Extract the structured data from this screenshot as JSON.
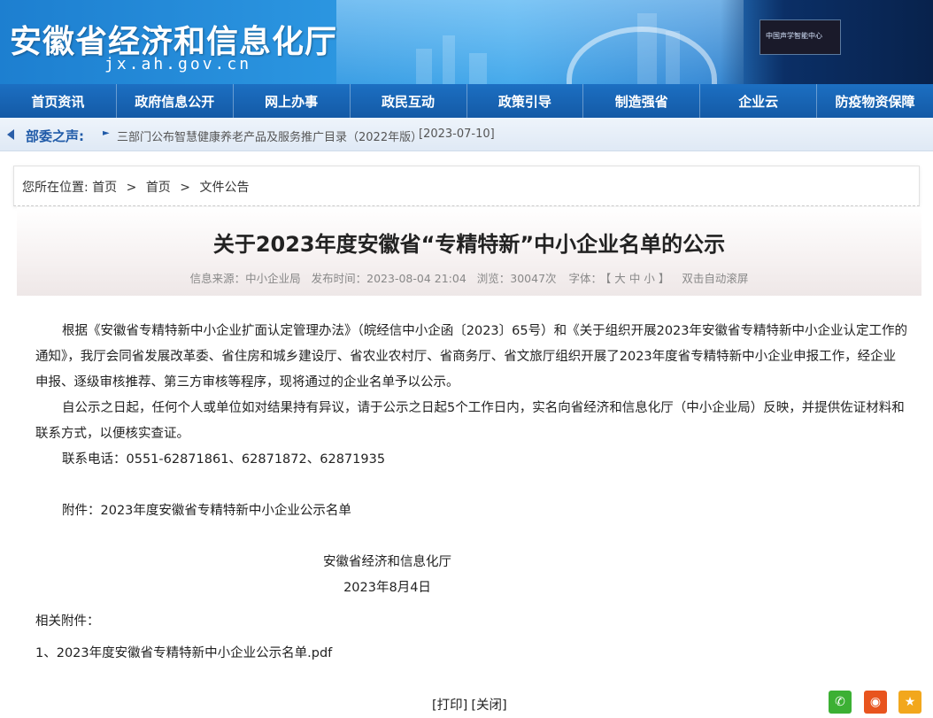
{
  "header": {
    "site_title": "安徽省经济和信息化厅",
    "site_domain": "jx.ah.gov.cn",
    "screen_text": "中国声学智能中心"
  },
  "nav": {
    "items": [
      {
        "label": "首页资讯"
      },
      {
        "label": "政府信息公开"
      },
      {
        "label": "网上办事"
      },
      {
        "label": "政民互动"
      },
      {
        "label": "政策引导"
      },
      {
        "label": "制造强省"
      },
      {
        "label": "企业云"
      },
      {
        "label": "防疫物资保障"
      }
    ]
  },
  "notice": {
    "label": "部委之声:",
    "text": "三部门公布智慧健康养老产品及服务推广目录（2022年版）",
    "date": "[2023-07-10]"
  },
  "breadcrumb": {
    "prefix": "您所在位置:",
    "items": [
      "首页",
      "首页",
      "文件公告"
    ],
    "separator": ">"
  },
  "article": {
    "title": "关于2023年度安徽省“专精特新”中小企业名单的公示",
    "meta": {
      "source": "信息来源：中小企业局",
      "published": "发布时间：2023-08-04 21:04",
      "views": "浏览：30047次",
      "font_label": "字体：",
      "font_open": "【",
      "font_large": "大",
      "font_medium": "中",
      "font_small": "小",
      "font_close": "】",
      "autoscroll": "双击自动滚屏"
    },
    "paragraphs": [
      "根据《安徽省专精特新中小企业扩面认定管理办法》（皖经信中小企函〔2023〕65号）和《关于组织开展2023年安徽省专精特新中小企业认定工作的通知》，我厅会同省发展改革委、省住房和城乡建设厅、省农业农村厅、省商务厅、省文旅厅组织开展了2023年度省专精特新中小企业申报工作，经企业申报、逐级审核推荐、第三方审核等程序，现将通过的企业名单予以公示。",
      "自公示之日起，任何个人或单位如对结果持有异议，请于公示之日起5个工作日内，实名向省经济和信息化厅（中小企业局）反映，并提供佐证材料和联系方式，以便核实查证。",
      "联系电话：0551-62871861、62871872、62871935"
    ],
    "attachment_line": "附件：2023年度安徽省专精特新中小企业公示名单",
    "signature_org": "安徽省经济和信息化厅",
    "signature_date": "2023年8月4日",
    "related_title": "相关附件：",
    "related_files": [
      "1、2023年度安徽省专精特新中小企业公示名单.pdf"
    ]
  },
  "actions": {
    "print": "[打印]",
    "close": "[关闭]"
  },
  "share": {
    "wechat_glyph": "✆",
    "weibo_glyph": "◉",
    "qzone_glyph": "★"
  },
  "colors": {
    "nav_bg": "#145aa6",
    "notice_label": "#1f5aa8",
    "wechat": "#3cb034",
    "weibo": "#e8541e",
    "qzone": "#f2a71d"
  }
}
